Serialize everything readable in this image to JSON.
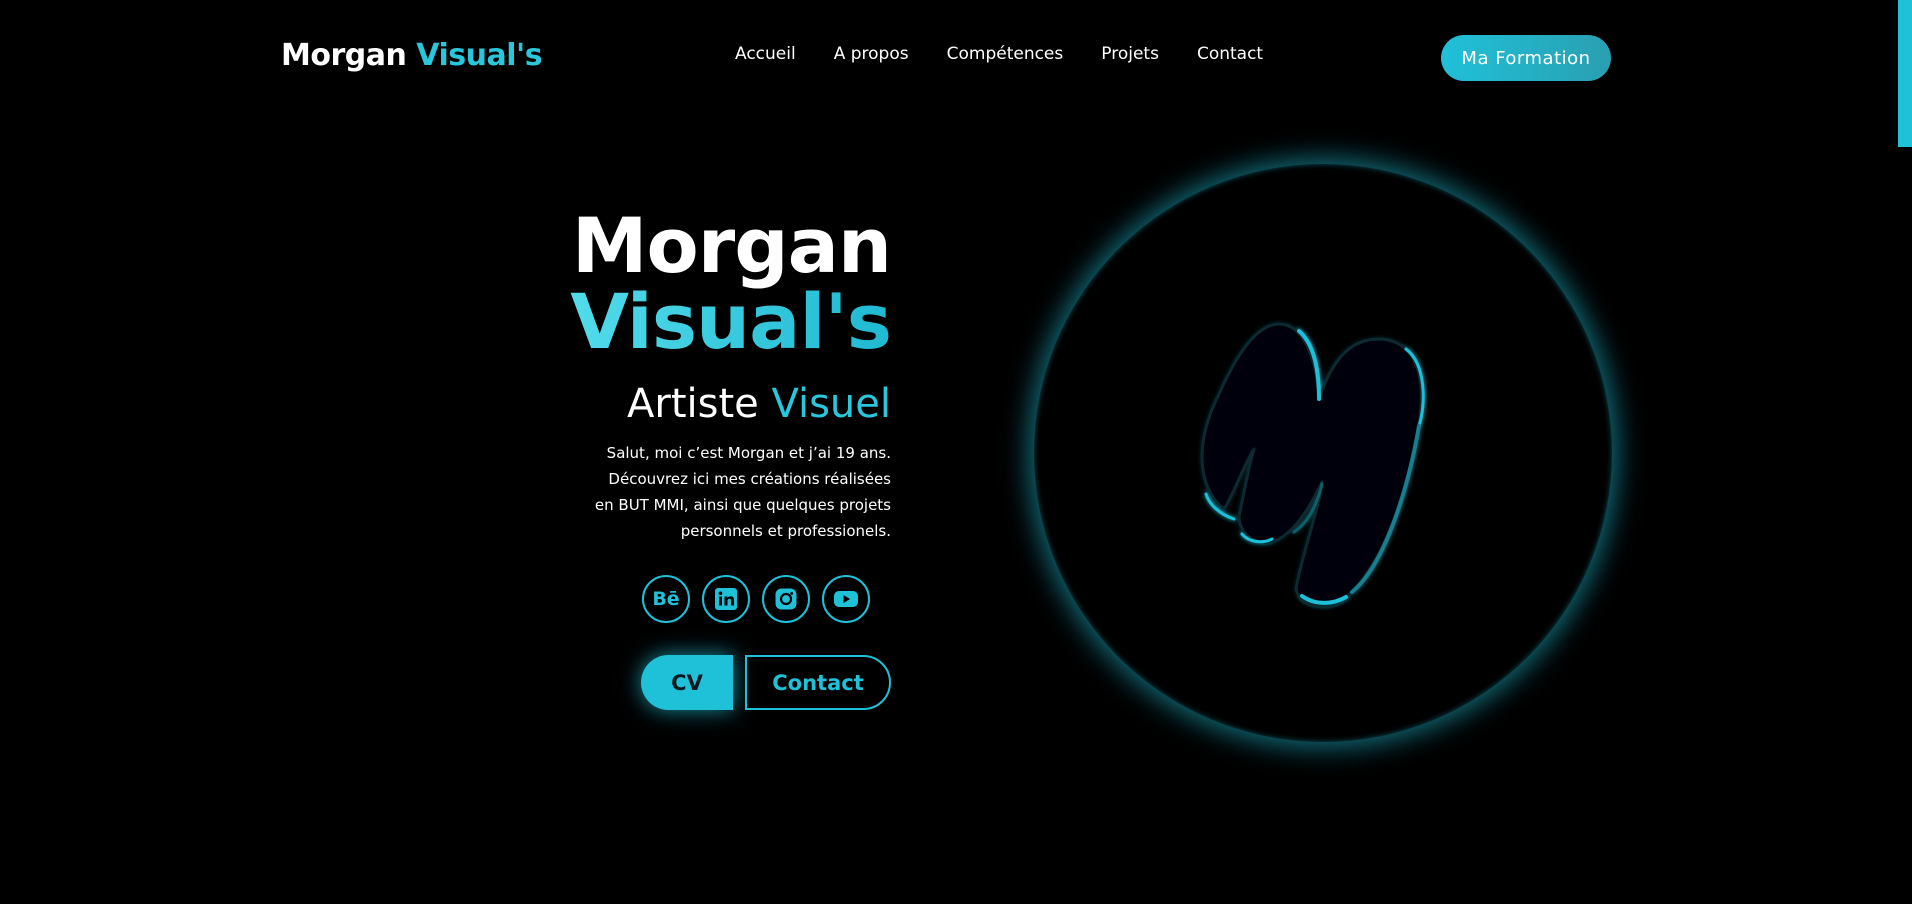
{
  "brand": {
    "name": "Morgan",
    "accent": "Visual's"
  },
  "nav": {
    "items": [
      "Accueil",
      "A propos",
      "Compétences",
      "Projets",
      "Contact"
    ]
  },
  "formation_button": "Ma Formation",
  "hero": {
    "title_line1": "Morgan",
    "title_line2": "Visual's",
    "subtitle_main": "Artiste",
    "subtitle_accent": "Visuel",
    "description": "Salut, moi c’est Morgan et j’ai 19 ans. Découvrez ici mes créations réalisées en BUT MMI, ainsi que quelques projets personnels et professionels."
  },
  "socials": [
    {
      "name": "behance-icon",
      "glyph": "Bē"
    },
    {
      "name": "linkedin-icon"
    },
    {
      "name": "instagram-icon"
    },
    {
      "name": "youtube-icon"
    }
  ],
  "cta": {
    "cv": "CV",
    "contact": "Contact"
  },
  "colors": {
    "background": "#000000",
    "accent": "#1fc1d9",
    "text": "#ffffff"
  }
}
